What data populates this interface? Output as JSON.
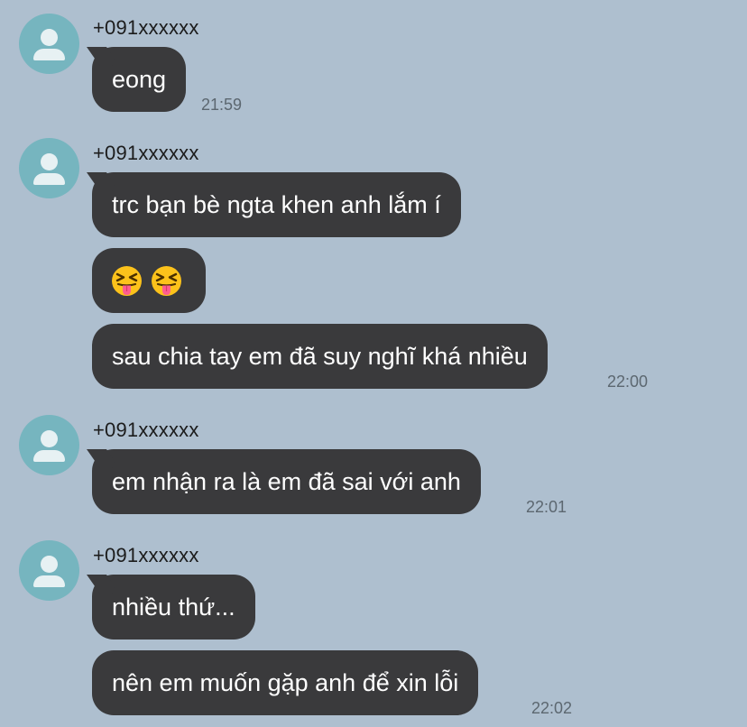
{
  "chat": {
    "groups": [
      {
        "sender": "+091xxxxxx",
        "messages": [
          {
            "text": "eong",
            "time": "21:59"
          }
        ]
      },
      {
        "sender": "+091xxxxxx",
        "messages": [
          {
            "text": "trc bạn bè ngta khen anh lắm í",
            "time": ""
          },
          {
            "text": "",
            "emoji": [
              "squinting-face-with-tongue-icon",
              "squinting-face-with-tongue-icon"
            ],
            "time": ""
          },
          {
            "text": "sau chia tay em đã suy nghĩ khá nhiều",
            "time": "22:00"
          }
        ]
      },
      {
        "sender": "+091xxxxxx",
        "messages": [
          {
            "text": "em nhận ra là em đã sai với anh",
            "time": "22:01"
          }
        ]
      },
      {
        "sender": "+091xxxxxx",
        "messages": [
          {
            "text": "nhiều thứ...",
            "time": ""
          },
          {
            "text": "nên em muốn gặp anh để xin lỗi",
            "time": "22:02"
          }
        ]
      }
    ]
  },
  "colors": {
    "background": "#aebfcf",
    "bubble": "#3a3a3c",
    "avatar": "#76b5bf"
  }
}
